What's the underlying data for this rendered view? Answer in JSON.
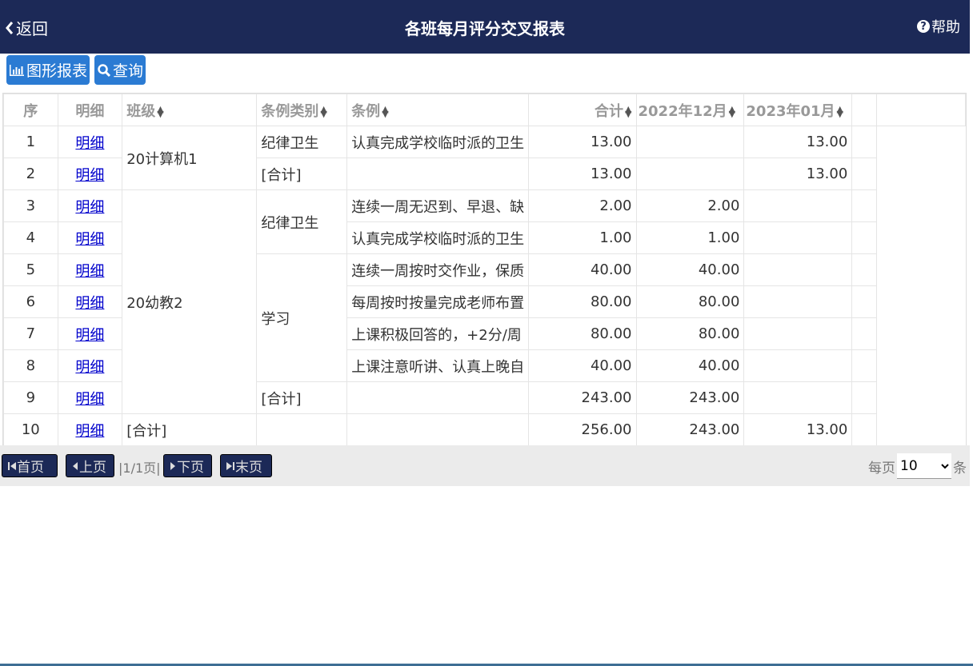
{
  "header": {
    "back_label": "返回",
    "title": "各班每月评分交叉报表",
    "help_label": "帮助"
  },
  "toolbar": {
    "chart_btn": "图形报表",
    "query_btn": "查询"
  },
  "table": {
    "columns": [
      "序",
      "明细",
      "班级",
      "条例类别",
      "条例",
      "合计",
      "2022年12月",
      "2023年01月"
    ],
    "detail_link": "明细",
    "rows": [
      {
        "no": "1",
        "class": "20计算机1",
        "category": "纪律卫生",
        "rule": "认真完成学校临时派的卫生",
        "total": "13.00",
        "m1": "",
        "m2": "13.00"
      },
      {
        "no": "2",
        "class": "",
        "category": "[合计]",
        "rule": "",
        "total": "13.00",
        "m1": "",
        "m2": "13.00"
      },
      {
        "no": "3",
        "class": "20幼教2",
        "category": "纪律卫生",
        "rule": "连续一周无迟到、早退、缺",
        "total": "2.00",
        "m1": "2.00",
        "m2": ""
      },
      {
        "no": "4",
        "class": "",
        "category": "",
        "rule": "认真完成学校临时派的卫生",
        "total": "1.00",
        "m1": "1.00",
        "m2": ""
      },
      {
        "no": "5",
        "class": "",
        "category": "学习",
        "rule": "连续一周按时交作业，保质",
        "total": "40.00",
        "m1": "40.00",
        "m2": ""
      },
      {
        "no": "6",
        "class": "",
        "category": "",
        "rule": "每周按时按量完成老师布置",
        "total": "80.00",
        "m1": "80.00",
        "m2": ""
      },
      {
        "no": "7",
        "class": "",
        "category": "",
        "rule": "上课积极回答的，+2分/周",
        "total": "80.00",
        "m1": "80.00",
        "m2": ""
      },
      {
        "no": "8",
        "class": "",
        "category": "",
        "rule": "上课注意听讲、认真上晚自",
        "total": "40.00",
        "m1": "40.00",
        "m2": ""
      },
      {
        "no": "9",
        "class": "",
        "category": "[合计]",
        "rule": "",
        "total": "243.00",
        "m1": "243.00",
        "m2": ""
      },
      {
        "no": "10",
        "class": "[合计]",
        "category": "",
        "rule": "",
        "total": "256.00",
        "m1": "243.00",
        "m2": "13.00"
      }
    ]
  },
  "pager": {
    "first": "首页",
    "prev": "上页",
    "info": "|1/1页|",
    "next": "下页",
    "last": "末页",
    "per_page_label": "每页",
    "per_page_value": "10",
    "per_page_unit": "条"
  }
}
